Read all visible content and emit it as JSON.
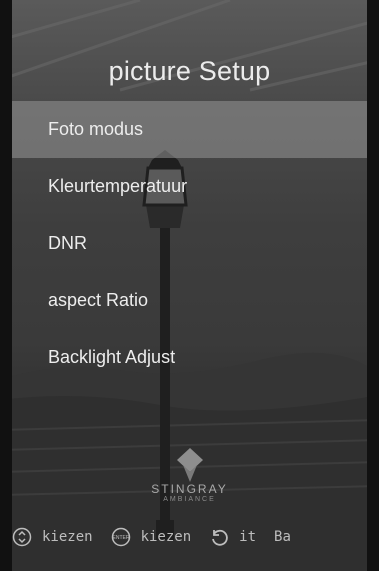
{
  "menu": {
    "title": "picture Setup",
    "items": [
      {
        "label": "Foto modus",
        "selected": true
      },
      {
        "label": "Kleurtemperatuur",
        "selected": false
      },
      {
        "label": "DNR",
        "selected": false
      },
      {
        "label": "aspect Ratio",
        "selected": false
      },
      {
        "label": "Backlight Adjust",
        "selected": false
      }
    ]
  },
  "brand": {
    "name": "STINGRAY",
    "sub": "AMBIANCE"
  },
  "hints": [
    {
      "icon": "up-down-icon",
      "label": "kiezen"
    },
    {
      "icon": "enter-icon",
      "label": "kiezen",
      "icon_text": "ENTER"
    },
    {
      "icon": "back-icon",
      "label": "it"
    },
    {
      "icon": "",
      "label": "Ba"
    }
  ]
}
